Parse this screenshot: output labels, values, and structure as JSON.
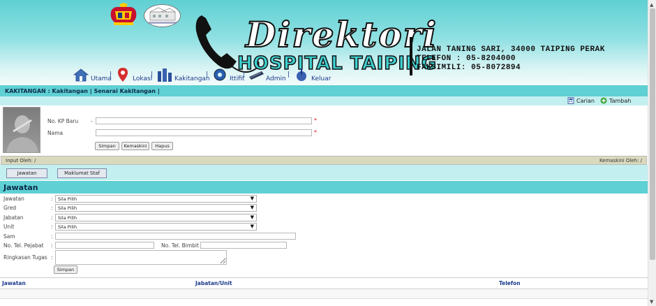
{
  "header": {
    "title_script": "Direktori",
    "title_main": "HOSPITAL TAIPING",
    "address_line": "JALAN TANING SARI, 34000 TAIPING PERAK",
    "phone_line": "TELEFON : 05-8204000",
    "fax_line": "FAKSIMILI: 05-8072894"
  },
  "nav": {
    "items": [
      {
        "label": "Utama",
        "icon": "house-icon"
      },
      {
        "label": "Lokasi",
        "icon": "map-pin-icon"
      },
      {
        "label": "Kakitangan",
        "icon": "people-icon"
      },
      {
        "label": "Ittifit",
        "icon": "gear-icon"
      },
      {
        "label": "Admin",
        "icon": "keyboard-icon"
      },
      {
        "label": "Keluar",
        "icon": "power-icon"
      }
    ],
    "separator": "|"
  },
  "breadcrumb": {
    "prefix": "KAKITANGAN :",
    "link1": "Kakitangan",
    "sep": "|",
    "link2": "Senarai Kakitangan",
    "end": "|"
  },
  "toolbar": {
    "search_label": "Carian",
    "add_label": "Tambah"
  },
  "identity_form": {
    "kp_label": "No. KP Baru",
    "nama_label": "Nama",
    "kp_value": "",
    "nama_value": "",
    "required_mark": "*",
    "dash": "-",
    "buttons": {
      "save": "Simpan",
      "update": "Kemaskini",
      "delete": "Hapus"
    }
  },
  "audit_bar": {
    "input_by": "Input Oleh: /",
    "updated_by": "Kemaskini Oleh: /"
  },
  "tabs": [
    {
      "label": "Jawatan"
    },
    {
      "label": "Maklumat Staf"
    }
  ],
  "jawatan_section": {
    "heading": "Jawatan",
    "colon": ":",
    "fields": {
      "jawatan": {
        "label": "Jawatan",
        "value": "Sila Pilih"
      },
      "gred": {
        "label": "Gred",
        "value": "Sila Pilih"
      },
      "jabatan": {
        "label": "Jabatan",
        "value": "Sila Pilih"
      },
      "unit": {
        "label": "Unit",
        "value": "Sila Pilih"
      },
      "sam": {
        "label": "Sam",
        "value": ""
      },
      "tel_pejabat": {
        "label": "No. Tel. Pejabat",
        "value": ""
      },
      "tel_bimbit": {
        "label": "No. Tel. Bimbit",
        "value": ""
      },
      "ringkasan": {
        "label": "Ringkasan Tugas",
        "value": ""
      }
    },
    "save_button": "Simpan"
  },
  "table": {
    "headers": [
      "Jawatan",
      "Jabatan/Unit",
      "Telefon"
    ]
  },
  "colors": {
    "accent": "#5fd0d3",
    "accent_light": "#c4eff0",
    "nav_text": "#1a3a8a",
    "audit_bar": "#d9d9bd"
  }
}
